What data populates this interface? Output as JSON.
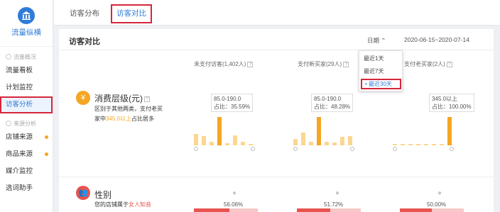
{
  "sidebar": {
    "logo_text": "流量纵横",
    "sections": [
      "流量概况",
      "来源分析"
    ],
    "items": [
      {
        "label": "流量看板"
      },
      {
        "label": "计划监控"
      },
      {
        "label": "访客分析"
      },
      {
        "label": "店铺来源"
      },
      {
        "label": "商品来源"
      },
      {
        "label": "媒介监控"
      },
      {
        "label": "选词助手"
      }
    ]
  },
  "tabs": [
    {
      "label": "访客分布"
    },
    {
      "label": "访客对比"
    }
  ],
  "panel": {
    "title": "访客对比",
    "date_label": "日期",
    "date_range": "2020-06-15~2020-07-14",
    "dropdown": [
      "最近1天",
      "最近7天",
      "最近30天"
    ]
  },
  "columns": [
    {
      "label": "未支付访客(1,402人)"
    },
    {
      "label": "支付新买家(29人)"
    },
    {
      "label": "支付老买家(2人)"
    }
  ],
  "rows": [
    {
      "title": "消费层级(元)",
      "desc_line1": "区别于其他两类，支付老买",
      "desc_line2_prefix": "家中",
      "desc_line2_hl": "345.0以上",
      "desc_line2_suffix": "占比居多",
      "tips": [
        {
          "range": "85.0-190.0",
          "ratio": "占比：35.59%"
        },
        {
          "range": "85.0-190.0",
          "ratio": "占比：48.28%"
        },
        {
          "range": "345.0以上",
          "ratio": "占比：100.00%"
        }
      ]
    },
    {
      "title": "性别",
      "desc_prefix": "您的店铺属于",
      "desc_hl": "女人知音",
      "percents": [
        "56.06%",
        "51.72%",
        "50.00%"
      ]
    }
  ],
  "chart_data": [
    {
      "type": "bar",
      "categories": [
        1,
        2,
        3,
        4,
        5,
        6,
        7,
        8
      ],
      "values": [
        4,
        3.2,
        1.3,
        10,
        0.8,
        3.5,
        1.3,
        0.6
      ],
      "highlight_index": 3
    },
    {
      "type": "bar",
      "categories": [
        1,
        2,
        3,
        4,
        5,
        6,
        7,
        8
      ],
      "values": [
        2.5,
        5,
        1.5,
        11,
        1.5,
        1.2,
        3.3,
        3.5
      ],
      "highlight_index": 3
    },
    {
      "type": "bar",
      "categories": [
        1,
        2,
        3,
        4,
        5,
        6,
        7,
        8
      ],
      "values": [
        0.5,
        0.5,
        0.5,
        0.5,
        0.5,
        0.5,
        0.5,
        11
      ],
      "highlight_index": 7
    }
  ]
}
